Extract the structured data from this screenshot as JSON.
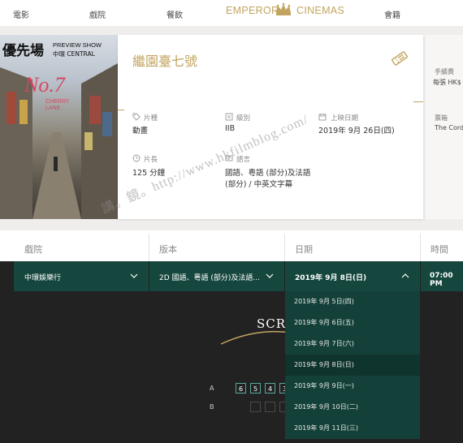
{
  "nav": {
    "items": [
      "電影",
      "戲院",
      "餐飲",
      "會籍"
    ],
    "brand_left": "EMPEROR",
    "brand_right": "CINEMAS",
    "brand_color": "#c2a460"
  },
  "poster": {
    "badge_big": "優先場",
    "badge_line1": "PREVIEW SHOW",
    "badge_line2": "中環 CENTRAL"
  },
  "movie": {
    "title": "繼園臺七號",
    "genre_label": "片種",
    "genre": "動畫",
    "rating_label": "級別",
    "rating": "IIB",
    "release_label": "上映日期",
    "release": "2019年 9月 26日(四)",
    "runtime_label": "片長",
    "runtime": "125 分鐘",
    "language_label": "語言",
    "language_line1": "國語、粵語 (部分)及法語",
    "language_line2": "(部分) / 中英文字幕"
  },
  "side": {
    "fee_label": "手續費",
    "fee_value": "每張 HK$",
    "venue_label": "票箱",
    "venue_value": "The Cord"
  },
  "selectors": {
    "cinema_label": "戲院",
    "version_label": "版本",
    "date_label": "日期",
    "time_label": "時間",
    "cinema_value": "中環娛樂行",
    "version_value": "2D 國語、粵語 (部分)及法語...",
    "date_value": "2019年 9月 8日(日)",
    "time_value": "07:00 PM"
  },
  "date_options": [
    "2019年 9月 5日(四)",
    "2019年 9月 6日(五)",
    "2019年 9月 7日(六)",
    "2019年 9月 8日(日)",
    "2019年 9月 9日(一)",
    "2019年 9月 10日(二)",
    "2019年 9月 11日(三)"
  ],
  "seating": {
    "screen_text": "SCR",
    "row_a": "A",
    "row_b": "B",
    "seats_a": [
      "6",
      "5",
      "4",
      "3"
    ]
  },
  "watermark": "講。鏡。http://www.hkfilmblog.com/",
  "colors": {
    "dark_green": "#15473f",
    "dark_bg": "#222222",
    "gold": "#c2a460"
  }
}
